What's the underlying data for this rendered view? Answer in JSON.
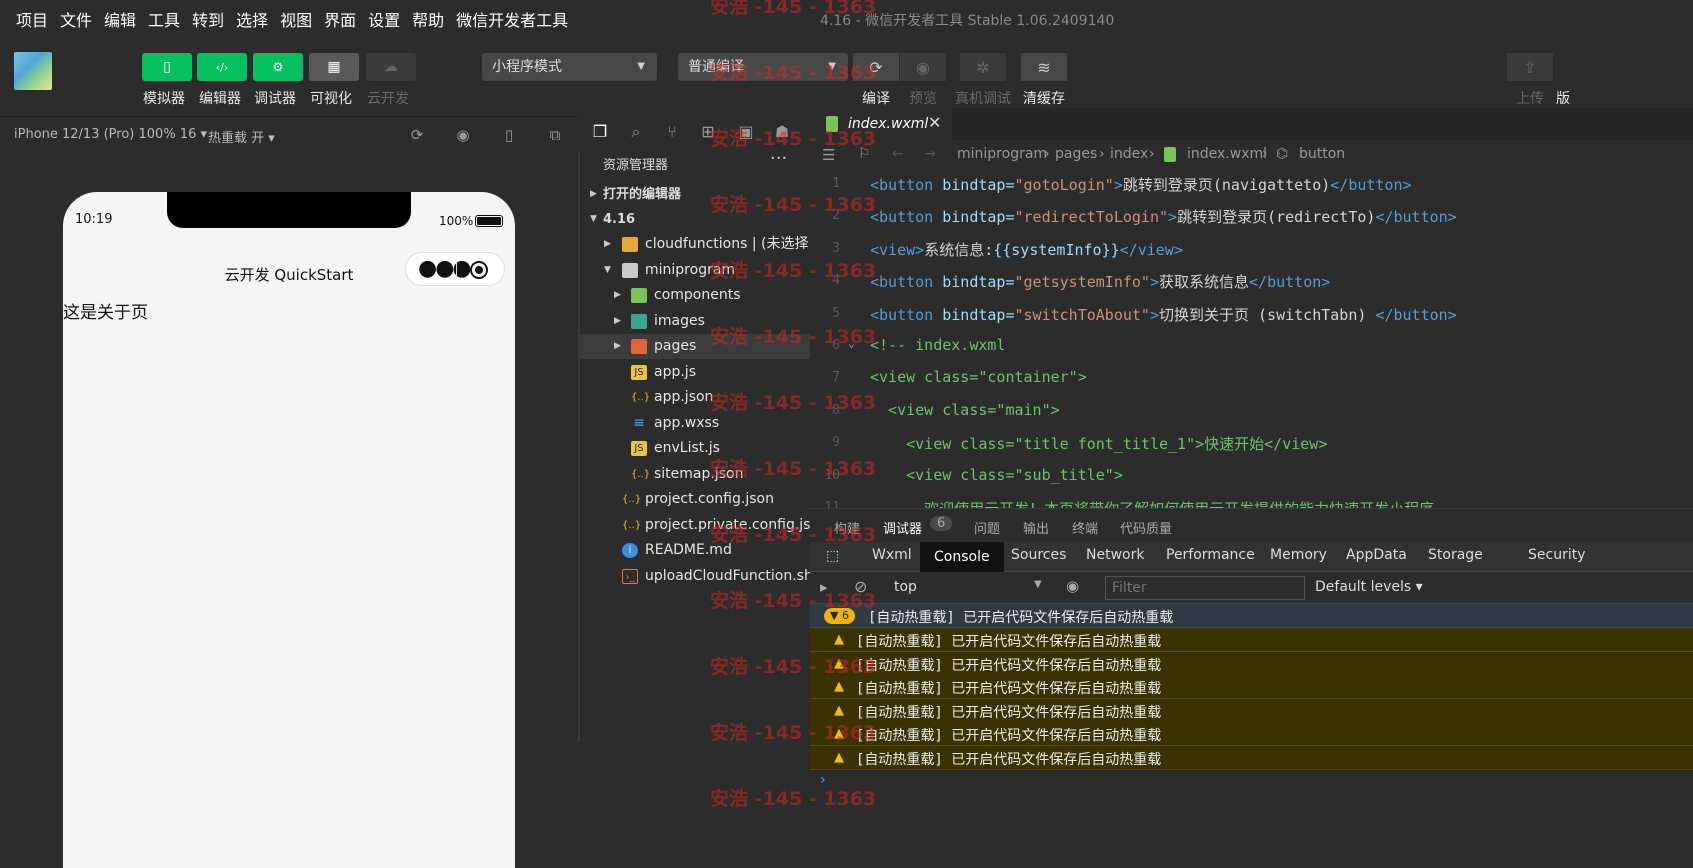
{
  "menubar": {
    "items": [
      "项目",
      "文件",
      "编辑",
      "工具",
      "转到",
      "选择",
      "视图",
      "界面",
      "设置",
      "帮助",
      "微信开发者工具"
    ],
    "window_title": "4.16 - 微信开发者工具 Stable 1.06.2409140"
  },
  "toolbar": {
    "simulator": "模拟器",
    "editor": "编辑器",
    "debugger": "调试器",
    "visual": "可视化",
    "cloud": "云开发",
    "mode_select": "小程序模式",
    "compile_select": "普通编译",
    "compile": "编译",
    "preview": "预览",
    "remote_debug": "真机调试",
    "clear_cache": "清缓存",
    "upload": "上传",
    "version_cut": "版"
  },
  "simulator": {
    "device": "iPhone 12/13 (Pro) 100% 16 ▾",
    "hot_reload": "热重载 开 ▾",
    "time": "10:19",
    "battery": "100%",
    "nav_title": "云开发 QuickStart",
    "page_text": "这是关于页"
  },
  "explorer": {
    "title": "资源管理器",
    "more": "···",
    "open_editors": "打开的编辑器",
    "project": "4.16",
    "tree": [
      {
        "name": "cloudfunctions | (未选择...",
        "type": "folder"
      },
      {
        "name": "miniprogram",
        "type": "folder-open"
      },
      {
        "name": "components",
        "type": "folder"
      },
      {
        "name": "images",
        "type": "folder"
      },
      {
        "name": "pages",
        "type": "folder"
      },
      {
        "name": "app.js",
        "type": "js"
      },
      {
        "name": "app.json",
        "type": "json"
      },
      {
        "name": "app.wxss",
        "type": "css"
      },
      {
        "name": "envList.js",
        "type": "js"
      },
      {
        "name": "sitemap.json",
        "type": "json"
      },
      {
        "name": "project.config.json",
        "type": "json"
      },
      {
        "name": "project.private.config.json",
        "type": "json"
      },
      {
        "name": "README.md",
        "type": "info"
      },
      {
        "name": "uploadCloudFunction.sh",
        "type": "sh"
      }
    ]
  },
  "editor": {
    "tab": "index.wxml",
    "breadcrumb": [
      "miniprogram",
      "pages",
      "index",
      "index.wxml",
      "button"
    ],
    "lines": [
      {
        "n": "1",
        "parts": [
          [
            "tag",
            "<button "
          ],
          [
            "attr",
            "bindtap="
          ],
          [
            "str",
            "\"gotoLogin\""
          ],
          [
            "tag",
            ">"
          ],
          [
            "txt",
            "跳转到登录页(navigatteto)"
          ],
          [
            "tag",
            "</button>"
          ]
        ]
      },
      {
        "n": "2",
        "parts": [
          [
            "tag",
            "<button "
          ],
          [
            "attr",
            "bindtap="
          ],
          [
            "str",
            "\"redirectToLogin\""
          ],
          [
            "tag",
            ">"
          ],
          [
            "txt",
            "跳转到登录页(redirectTo)"
          ],
          [
            "tag",
            "</button>"
          ]
        ]
      },
      {
        "n": "3",
        "parts": [
          [
            "tag",
            "<view>"
          ],
          [
            "txt",
            "系统信息:"
          ],
          [
            "attr",
            "{{systemInfo}}"
          ],
          [
            "tag",
            "</view>"
          ]
        ]
      },
      {
        "n": "4",
        "parts": [
          [
            "tag",
            "<button "
          ],
          [
            "attr",
            "bindtap="
          ],
          [
            "str",
            "\"getsystemInfo\""
          ],
          [
            "tag",
            ">"
          ],
          [
            "txt",
            "获取系统信息"
          ],
          [
            "tag",
            "</button>"
          ]
        ]
      },
      {
        "n": "5",
        "parts": [
          [
            "tag",
            "<button "
          ],
          [
            "attr",
            "bindtap="
          ],
          [
            "str",
            "\"switchToAbout\""
          ],
          [
            "tag",
            ">"
          ],
          [
            "txt",
            "切换到关于页 (switchTabn) "
          ],
          [
            "tag",
            "</button>"
          ]
        ]
      },
      {
        "n": "6",
        "parts": [
          [
            "green",
            "<!-- index.wxml"
          ]
        ]
      },
      {
        "n": "7",
        "parts": [
          [
            "green",
            "<view class=\"container\">"
          ]
        ]
      },
      {
        "n": "8",
        "parts": [
          [
            "green",
            "  <view class=\"main\">"
          ]
        ]
      },
      {
        "n": "9",
        "parts": [
          [
            "green",
            "    <view class=\"title font_title_1\">快速开始</view>"
          ]
        ]
      },
      {
        "n": "10",
        "parts": [
          [
            "green",
            "    <view class=\"sub_title\">"
          ]
        ]
      },
      {
        "n": "11",
        "parts": [
          [
            "green",
            "      欢迎使用云开发！本页将带你了解如何使用云开发提供的能力快速开发小程序"
          ]
        ]
      }
    ]
  },
  "debug": {
    "tabs": [
      "构建",
      "调试器",
      "问题",
      "输出",
      "终端",
      "代码质量"
    ],
    "debugger_count": "6",
    "devtools_tabs": [
      "Wxml",
      "Console",
      "Sources",
      "Network",
      "Performance",
      "Memory",
      "AppData",
      "Storage",
      "Security"
    ],
    "context": "top",
    "filter_placeholder": "Filter",
    "levels": "Default levels ▾",
    "group_count": "▼ 6",
    "group_message": "[自动热重载] 已开启代码文件保存后自动热重载",
    "messages": [
      "[自动热重载] 已开启代码文件保存后自动热重载",
      "[自动热重载] 已开启代码文件保存后自动热重载",
      "[自动热重载] 已开启代码文件保存后自动热重载",
      "[自动热重载] 已开启代码文件保存后自动热重载",
      "[自动热重载] 已开启代码文件保存后自动热重载",
      "[自动热重载] 已开启代码文件保存后自动热重载"
    ],
    "prompt": "›"
  },
  "watermark": "安浩 -145 - 1363",
  "colors": {
    "accent_green": "#07c160",
    "warning": "#f0c000"
  }
}
